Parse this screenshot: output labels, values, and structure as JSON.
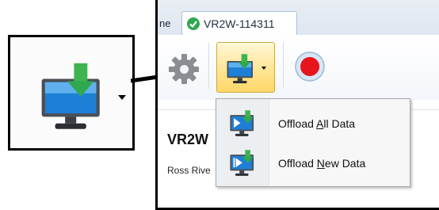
{
  "tabs": {
    "previous_label_fragment": "ne",
    "active_label": "VR2W-114311"
  },
  "content": {
    "device_title": "VR2W",
    "device_subtitle": "Ross Rive"
  },
  "menu": {
    "items": [
      {
        "before": "Offload ",
        "accel": "A",
        "after": "ll Data"
      },
      {
        "before": "Offload ",
        "accel": "N",
        "after": "ew Data"
      }
    ]
  },
  "icons": {
    "gear": "gear-icon",
    "offload": "monitor-download-icon",
    "record": "record-icon",
    "check": "check-circle-icon"
  },
  "colors": {
    "accent_green": "#2fa84f",
    "record_red": "#e8141c",
    "highlight_gold": "#ffd766",
    "monitor_blue": "#1e7fd6"
  }
}
